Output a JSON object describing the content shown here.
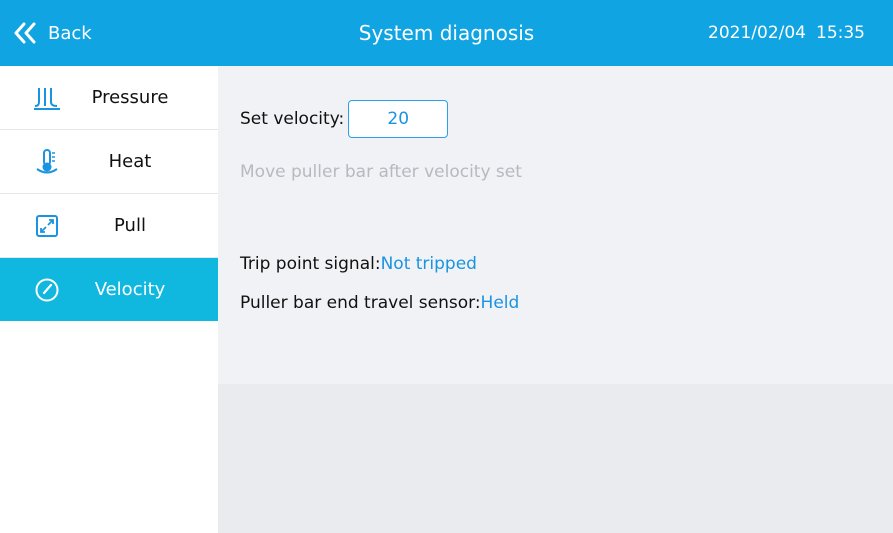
{
  "header": {
    "back_label": "Back",
    "title": "System diagnosis",
    "date": "2021/02/04",
    "time": "15:35",
    "color": "#10a4e3"
  },
  "sidebar": {
    "items": [
      {
        "label": "Pressure",
        "icon": "pressure-icon",
        "active": false
      },
      {
        "label": "Heat",
        "icon": "thermometer-icon",
        "active": false
      },
      {
        "label": "Pull",
        "icon": "expand-arrows-icon",
        "active": false
      },
      {
        "label": "Velocity",
        "icon": "speedometer-icon",
        "active": true
      }
    ],
    "active_color": "#10b8e0"
  },
  "main": {
    "set_velocity_label": "Set velocity:",
    "set_velocity_value": "20",
    "hint": "Move puller bar after velocity set",
    "trip_label": "Trip point signal:",
    "trip_value": "Not tripped",
    "sensor_label": "Puller bar end travel sensor:",
    "sensor_value": "Held",
    "value_color": "#1a94e0"
  }
}
